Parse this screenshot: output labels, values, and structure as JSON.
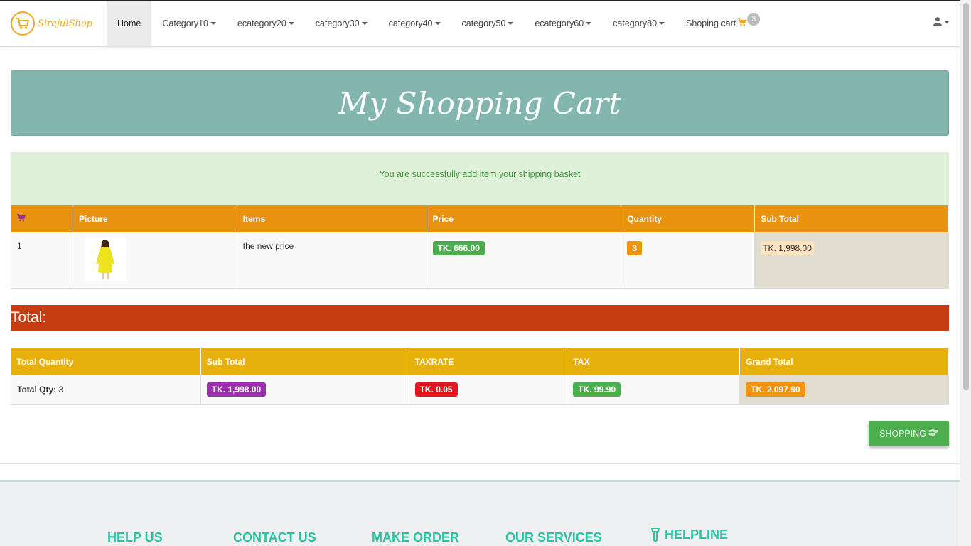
{
  "brand": {
    "name": "SirajulShop"
  },
  "nav": {
    "items": [
      {
        "label": "Home",
        "active": true
      },
      {
        "label": "Category10",
        "dropdown": true
      },
      {
        "label": "ecategory20",
        "dropdown": true
      },
      {
        "label": "category30",
        "dropdown": true
      },
      {
        "label": "category40",
        "dropdown": true
      },
      {
        "label": "category50",
        "dropdown": true
      },
      {
        "label": "ecategory60",
        "dropdown": true
      },
      {
        "label": "category80",
        "dropdown": true
      }
    ],
    "cart_label": "Shoping cart",
    "cart_count": "3"
  },
  "banner": {
    "title": "My Shopping Cart"
  },
  "alert": {
    "message": "You are successfully add item your shipping basket"
  },
  "cart_table": {
    "headers": [
      "",
      "Picture",
      "Items",
      "Price",
      "Quantity",
      "Sub Total"
    ],
    "rows": [
      {
        "index": "1",
        "item": "the new price",
        "price": "TK. 666.00",
        "quantity": "3",
        "subtotal": "TK. 1,998.00"
      }
    ]
  },
  "total": {
    "label": "Total:"
  },
  "summary_table": {
    "headers": [
      "Total Quantity",
      "Sub Total",
      "TAXRATE",
      "TAX",
      "Grand Total"
    ],
    "qty_label": "Total Qty:",
    "qty_value": "3",
    "subtotal": "TK. 1,998.00",
    "taxrate": "TK. 0.05",
    "tax": "TK. 99.90",
    "grand_total": "TK. 2,097.90"
  },
  "shopping_button": {
    "label": "SHOPPING"
  },
  "footer": {
    "headings": [
      "HELP US",
      "CONTACT US",
      "MAKE ORDER",
      "OUR SERVICES",
      "HELPLINE"
    ]
  },
  "colors": {
    "nav_accent": "#f0a81f",
    "banner": "#83b6af",
    "cart_header": "#e8920f",
    "total_bar": "#c53d10",
    "summary_header": "#e8b00c",
    "success": "#4cae4c",
    "footer_heading": "#2bc4a3"
  }
}
